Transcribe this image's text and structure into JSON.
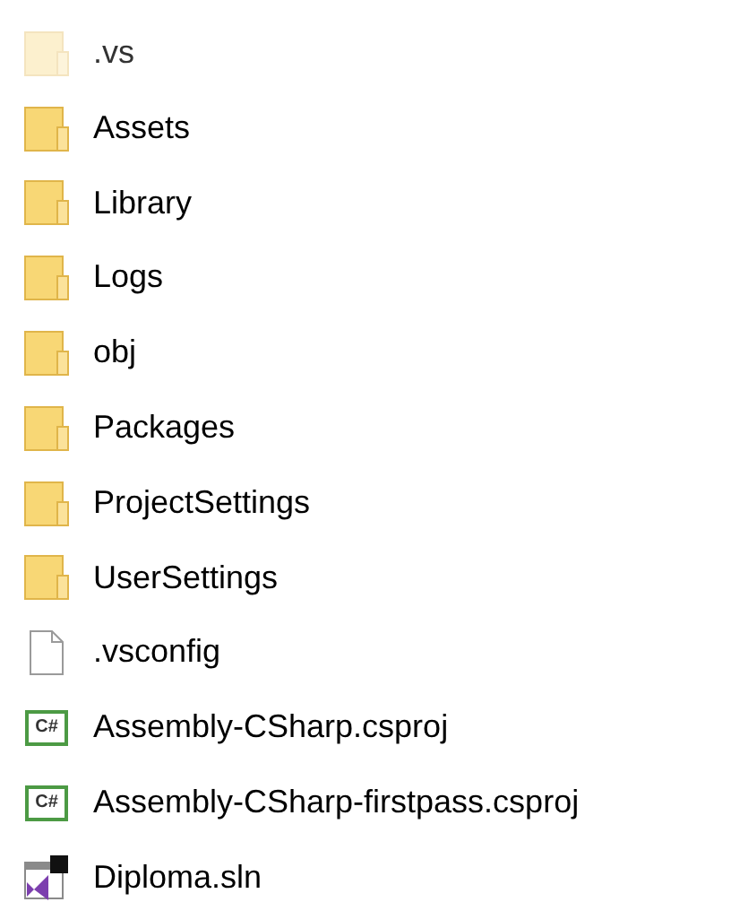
{
  "items": [
    {
      "kind": "folder",
      "name": ".vs",
      "hidden": true
    },
    {
      "kind": "folder",
      "name": "Assets",
      "hidden": false
    },
    {
      "kind": "folder",
      "name": "Library",
      "hidden": false
    },
    {
      "kind": "folder",
      "name": "Logs",
      "hidden": false
    },
    {
      "kind": "folder",
      "name": "obj",
      "hidden": false
    },
    {
      "kind": "folder",
      "name": "Packages",
      "hidden": false
    },
    {
      "kind": "folder",
      "name": "ProjectSettings",
      "hidden": false
    },
    {
      "kind": "folder",
      "name": "UserSettings",
      "hidden": false
    },
    {
      "kind": "file",
      "name": ".vsconfig",
      "hidden": false
    },
    {
      "kind": "csharp",
      "name": "Assembly-CSharp.csproj",
      "icon_text": "C#",
      "hidden": false
    },
    {
      "kind": "csharp",
      "name": "Assembly-CSharp-firstpass.csproj",
      "icon_text": "C#",
      "hidden": false
    },
    {
      "kind": "solution",
      "name": "Diploma.sln",
      "hidden": false
    }
  ]
}
